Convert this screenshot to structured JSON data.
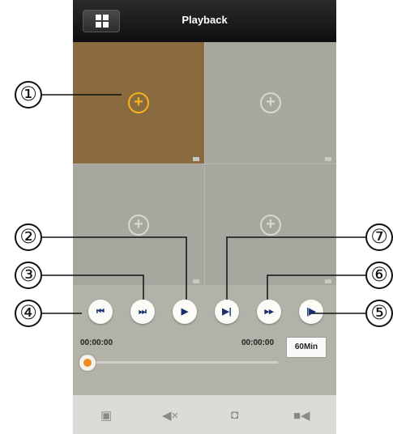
{
  "header": {
    "title": "Playback"
  },
  "grid": {
    "cells": [
      {
        "selected": true
      },
      {
        "selected": false
      },
      {
        "selected": false
      },
      {
        "selected": false
      }
    ]
  },
  "controls": {
    "buttons": [
      {
        "name": "skip-to-start-button",
        "icon": "skip-back-icon",
        "glyph": "⏮"
      },
      {
        "name": "skip-to-end-button",
        "icon": "skip-forward-icon",
        "glyph": "⏭"
      },
      {
        "name": "play-button",
        "icon": "play-icon",
        "glyph": "▶"
      },
      {
        "name": "step-forward-button",
        "icon": "step-forward-icon",
        "glyph": "⏯"
      },
      {
        "name": "fast-forward-button",
        "icon": "fast-forward-icon",
        "glyph": "⏩"
      },
      {
        "name": "slow-play-button",
        "icon": "slow-play-icon",
        "glyph": "⏵"
      }
    ],
    "start_time": "00:00:00",
    "end_time": "00:00:00",
    "duration_label": "60Min",
    "progress": 0
  },
  "bottom_bar": {
    "icons": [
      "close-all-icon",
      "mute-icon",
      "snapshot-icon",
      "record-icon"
    ]
  },
  "callouts": [
    "①",
    "②",
    "③",
    "④",
    "⑤",
    "⑥",
    "⑦"
  ],
  "colors": {
    "selected_cell": "#8a6b3f",
    "accent": "#f6b21c",
    "progress_dot": "#f28a22",
    "button_icon": "#1c2e6a"
  }
}
